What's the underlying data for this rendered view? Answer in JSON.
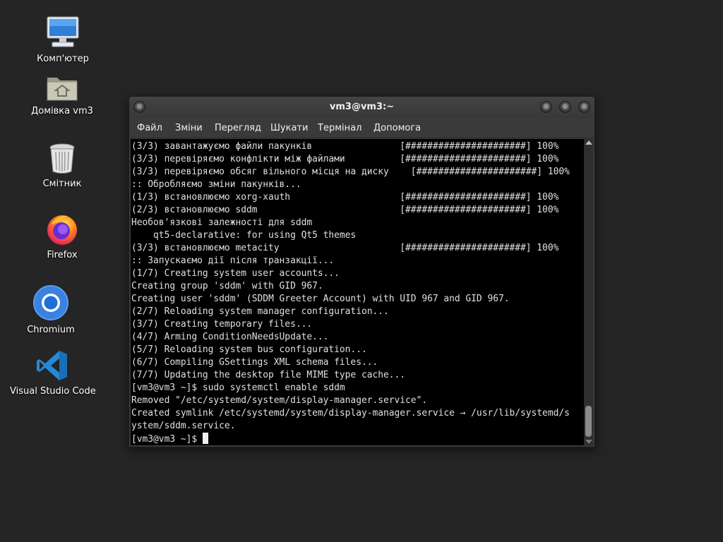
{
  "desktop": {
    "icons": [
      {
        "name": "computer-icon",
        "label": "Комп'ютер"
      },
      {
        "name": "home-folder-icon",
        "label": "Домівка vm3"
      },
      {
        "name": "trash-icon",
        "label": "Смітник"
      },
      {
        "name": "firefox-icon",
        "label": "Firefox"
      },
      {
        "name": "chromium-icon",
        "label": "Chromium"
      },
      {
        "name": "vscode-icon",
        "label": "Visual Studio Code"
      }
    ]
  },
  "window": {
    "title": "vm3@vm3:~",
    "menu": [
      "Файл",
      "Зміни",
      "Перегляд",
      "Шукати",
      "Термінал",
      "Допомога"
    ]
  },
  "terminal": {
    "lines": [
      "(3/3) завантажуємо файли пакунків                [######################] 100%",
      "(3/3) перевіряємо конфлікти між файлами          [######################] 100%",
      "(3/3) перевіряємо обсяг вільного місця на диску    [######################] 100%",
      ":: Обробляємо зміни пакунків...",
      "(1/3) встановлюємо xorg-xauth                    [######################] 100%",
      "(2/3) встановлюємо sddm                          [######################] 100%",
      "Необов'язкові залежності для sddm",
      "    qt5-declarative: for using Qt5 themes",
      "(3/3) встановлюємо metacity                      [######################] 100%",
      ":: Запускаємо дії після транзакції...",
      "(1/7) Creating system user accounts...",
      "Creating group 'sddm' with GID 967.",
      "Creating user 'sddm' (SDDM Greeter Account) with UID 967 and GID 967.",
      "(2/7) Reloading system manager configuration...",
      "(3/7) Creating temporary files...",
      "(4/7) Arming ConditionNeedsUpdate...",
      "(5/7) Reloading system bus configuration...",
      "(6/7) Compiling GSettings XML schema files...",
      "(7/7) Updating the desktop file MIME type cache...",
      "[vm3@vm3 ~]$ sudo systemctl enable sddm",
      "Removed \"/etc/systemd/system/display-manager.service\".",
      "Created symlink /etc/systemd/system/display-manager.service → /usr/lib/systemd/s",
      "ystem/sddm.service."
    ],
    "prompt": "[vm3@vm3 ~]$ "
  }
}
